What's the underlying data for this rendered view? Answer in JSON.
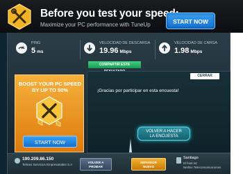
{
  "ad": {
    "headline": "Before you test your speed:",
    "sub": "Maximize your PC performance with TuneUp",
    "start_label": "START NOW"
  },
  "stats": {
    "ping": {
      "label": "PING",
      "value": "5",
      "unit": "ms"
    },
    "download": {
      "label": "VELOCIDAD DE DESCARGA",
      "value": "19.96",
      "unit": "Mbps"
    },
    "upload": {
      "label": "VELOCIDAD DE CARGA",
      "value": "1.98",
      "unit": "Mbps"
    }
  },
  "share_label": "COMPARTIR ESTE RESULTADO",
  "boost": {
    "headline_1": "BOOST YOUR PC SPEED",
    "headline_2": "BY UP TO 50%",
    "start_label": "START NOW"
  },
  "survey": {
    "close_label": "CERRAR",
    "message": "¡Gracias por participar en esta encuesta!",
    "retake_label_1": "VOLVER A HACER",
    "retake_label_2": "LA ENCUESTA"
  },
  "footer": {
    "ip": "190.209.86.150",
    "isp": "Telmex Servicios Empresariales S.A",
    "retest_1": "VOLVER A",
    "retest_2": "PROBAR",
    "server_1": "SERVIDOR",
    "server_2": "NUEVO",
    "city": "Santiago",
    "host_1": "El host es:",
    "host_2": "Netline Telecomunicaciones"
  },
  "colors": {
    "accent_blue": "#146fd0",
    "share_green": "#1a9a56",
    "boost_orange": "#dd7a0e",
    "app_bg": "#1c2c35"
  }
}
